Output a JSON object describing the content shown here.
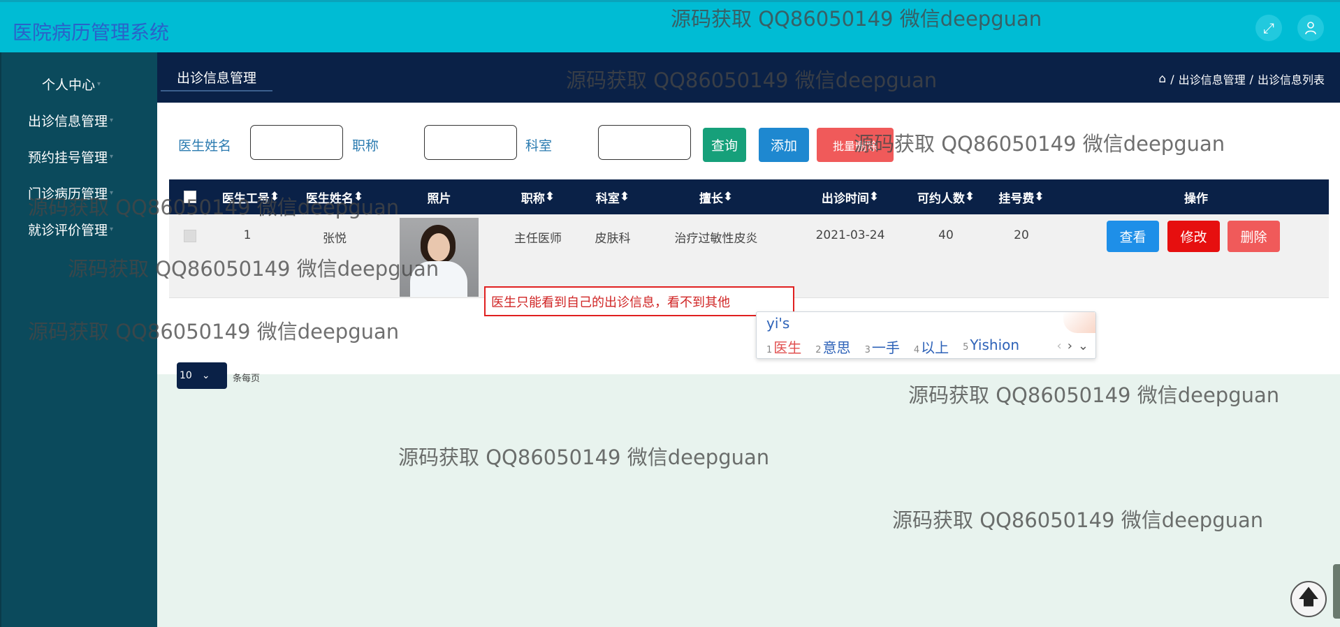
{
  "app": {
    "title": "医院病历管理系统"
  },
  "header": {
    "fullscreen_icon": "expand-icon",
    "user_icon": "user-icon"
  },
  "sidebar": {
    "items": [
      {
        "label": "个人中心"
      },
      {
        "label": "出诊信息管理"
      },
      {
        "label": "预约挂号管理"
      },
      {
        "label": "门诊病历管理"
      },
      {
        "label": "就诊评价管理"
      }
    ]
  },
  "tab": {
    "label": "出诊信息管理"
  },
  "breadcrumb": {
    "items": [
      "出诊信息管理",
      "出诊信息列表"
    ],
    "separator": "/"
  },
  "search": {
    "doctor_name_label": "医生姓名",
    "title_label": "职称",
    "dept_label": "科室",
    "query_button": "查询",
    "add_button": "添加",
    "batch_delete_button": "批量删除"
  },
  "table": {
    "columns": [
      "医生工号",
      "医生姓名",
      "照片",
      "职称",
      "科室",
      "擅长",
      "出诊时间",
      "可约人数",
      "挂号费",
      "操作"
    ],
    "rows": [
      {
        "doctor_id": "1",
        "doctor_name": "张悦",
        "title": "主任医师",
        "dept": "皮肤科",
        "specialty": "治疗过敏性皮炎",
        "visit_time": "2021-03-24",
        "quota": "40",
        "fee": "20",
        "actions": {
          "view": "查看",
          "edit": "修改",
          "delete": "删除"
        }
      }
    ]
  },
  "annotation": {
    "text": "医生只能看到自己的出诊信息，看不到其他"
  },
  "pager": {
    "page_size": "10",
    "per_page_text": "条每页"
  },
  "ime": {
    "input": "yi's",
    "candidates": [
      {
        "n": "1",
        "text": "医生"
      },
      {
        "n": "2",
        "text": "意思"
      },
      {
        "n": "3",
        "text": "一手"
      },
      {
        "n": "4",
        "text": "以上"
      },
      {
        "n": "5",
        "text": "Yishion"
      }
    ]
  },
  "watermark": {
    "text": "源码获取 QQ86050149 微信deepguan"
  },
  "colors": {
    "header": "#00bcd4",
    "sidebar": "#0b4a5c",
    "subbar": "#0a2147",
    "query_button": "#16a07a",
    "add_button": "#1e88d0",
    "batch_delete_button": "#f05a5a",
    "view_button": "#1e8fe8",
    "edit_button": "#e60f0f",
    "delete_button": "#f05a5a"
  }
}
